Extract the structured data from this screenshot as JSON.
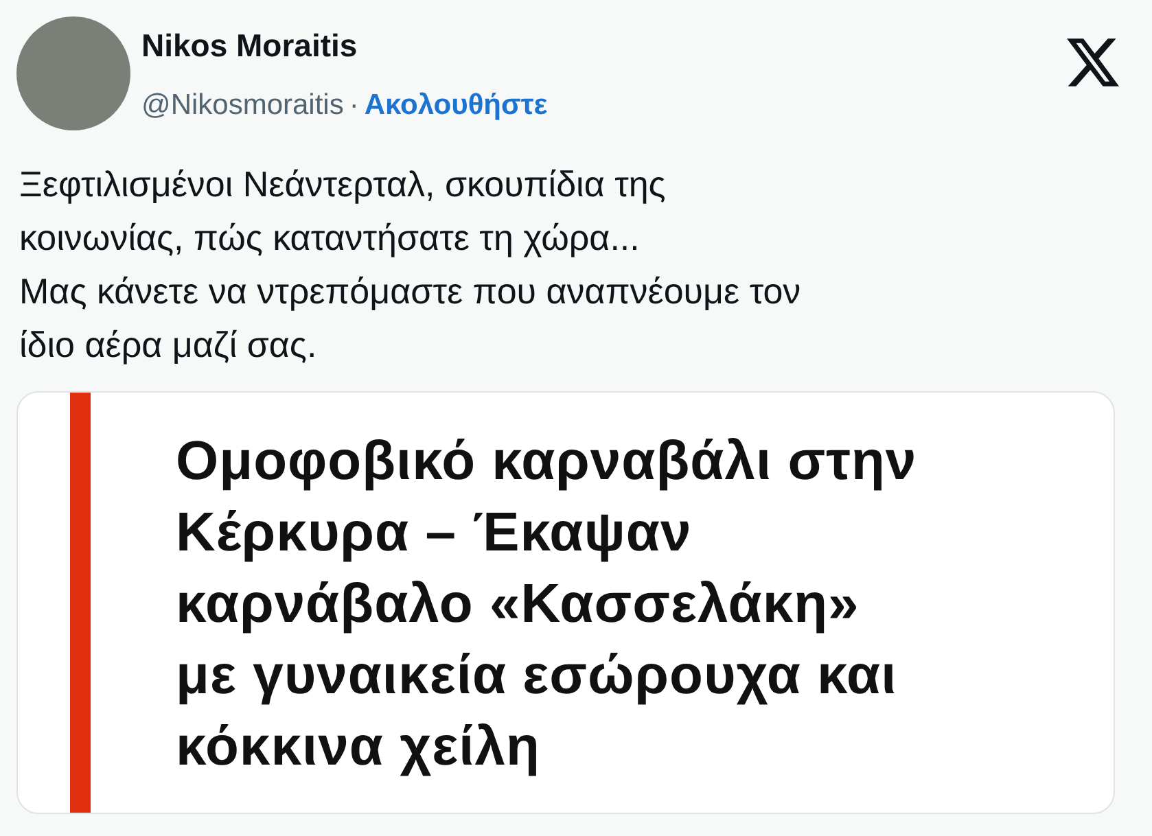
{
  "author": {
    "name": "Nikos Moraitis",
    "handle": "@Nikosmoraitis",
    "separator": "·",
    "follow_label": "Ακολουθήστε"
  },
  "tweet_text": [
    "Ξεφτιλισμένοι Νεάντερταλ, σκουπίδια της",
    "κοινωνίας, πώς καταντήσατε τη χώρα...",
    "Μας κάνετε να ντρεπόμαστε που αναπνέουμε τον",
    "ίδιο αέρα μαζί σας."
  ],
  "media_card": {
    "headline": [
      "Ομοφοβικό καρναβάλι στην",
      "Κέρκυρα – Έκαψαν",
      "καρνάβαλο «Κασσελάκη»",
      "με γυναικεία εσώρουχα και",
      "κόκκινα χείλη"
    ]
  }
}
